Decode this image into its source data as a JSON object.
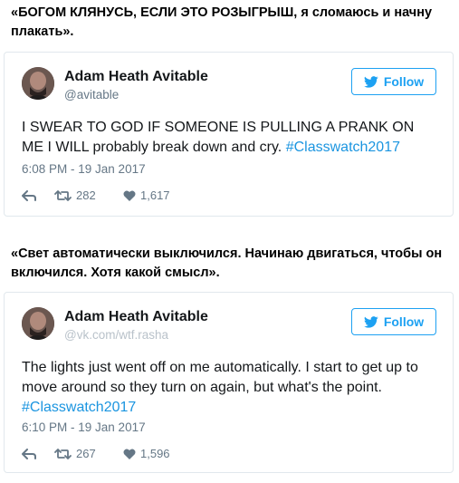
{
  "captions": [
    "«БОГОМ КЛЯНУСЬ, ЕСЛИ ЭТО РОЗЫГРЫШ, я сломаюсь и начну плакать».",
    "«Свет автоматически выключился. Начинаю двигаться, чтобы он включился. Хотя какой смысл»."
  ],
  "tweets": [
    {
      "name": "Adam Heath Avitable",
      "handle": "@avitable",
      "follow_label": "Follow",
      "text": "I SWEAR TO GOD IF SOMEONE IS PULLING A PRANK ON ME I WILL probably break down and cry.",
      "hashtag": "#Classwatch2017",
      "timestamp": "6:08 PM - 19 Jan 2017",
      "retweets": "282",
      "likes": "1,617"
    },
    {
      "name": "Adam Heath Avitable",
      "handle": "@vk.com/wtf.rasha",
      "follow_label": "Follow",
      "text": "The lights just went off on me automatically. I start to get up to move around so they turn on again, but what's the point.",
      "hashtag": "#Classwatch2017",
      "timestamp": "6:10 PM - 19 Jan 2017",
      "retweets": "267",
      "likes": "1,596"
    }
  ],
  "colors": {
    "accent": "#1da1f2",
    "hashtag": "#1b95e0",
    "muted": "#657786",
    "border": "#e1e8ed"
  },
  "icons": {
    "follow": "twitter-bird-icon",
    "reply": "reply-icon",
    "retweet": "retweet-icon",
    "like": "heart-icon"
  }
}
